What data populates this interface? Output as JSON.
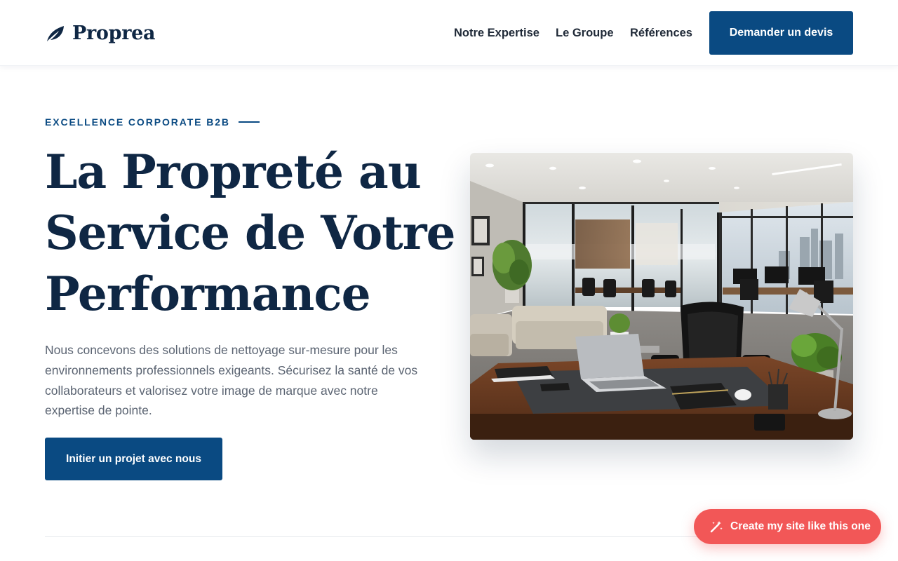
{
  "header": {
    "brand": "Proprea",
    "logo_icon": "leaf-icon",
    "nav": [
      {
        "label": "Notre Expertise"
      },
      {
        "label": "Le Groupe"
      },
      {
        "label": "Références"
      }
    ],
    "cta_label": "Demander un devis"
  },
  "hero": {
    "eyebrow": "EXCELLENCE CORPORATE B2B",
    "title_lines": [
      "La Propreté au",
      "Service de Votre",
      "Performance"
    ],
    "description": "Nous concevons des solutions de nettoyage sur-mesure pour les environnements professionnels exigeants. Sécurisez la santé de vos collaborateurs et valorisez votre image de marque avec notre expertise de pointe.",
    "cta_label": "Initier un projet avec nous",
    "image_subject": "modern corporate office with glass partitions, executive desk, leather chair, lounge sofas and city view"
  },
  "floating_cta": {
    "label": "Create my site like this one",
    "icon": "magic-wand-icon"
  },
  "colors": {
    "navy": "#0f2744",
    "primary": "#0a4a82",
    "text_muted": "#5b6472",
    "floating_accent": "#f25757",
    "divider": "#e4e7ec"
  }
}
